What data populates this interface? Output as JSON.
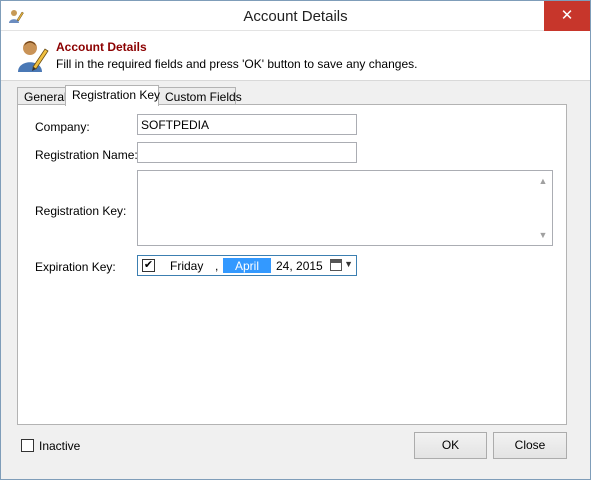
{
  "window": {
    "title": "Account Details",
    "close_glyph": "✕"
  },
  "header": {
    "title": "Account Details",
    "subtitle": "Fill in the required fields and press 'OK' button to save any changes."
  },
  "tabs": [
    {
      "label": "General",
      "active": false
    },
    {
      "label": "Registration Key",
      "active": true
    },
    {
      "label": "Custom Fields",
      "active": false
    }
  ],
  "form": {
    "company": {
      "label": "Company:",
      "value": "SOFTPEDIA"
    },
    "registration_name": {
      "label": "Registration Name:",
      "value": ""
    },
    "registration_key": {
      "label": "Registration Key:",
      "value": ""
    },
    "expiration_key": {
      "label": "Expiration Key:",
      "checked": true,
      "check_glyph": "✔",
      "weekday": "Friday",
      "separator": ",",
      "month": "April",
      "day_year": "24, 2015",
      "dropdown_glyph": "▼"
    }
  },
  "footer": {
    "inactive_label": "Inactive",
    "ok_label": "OK",
    "close_label": "Close"
  },
  "icons": {
    "app_icon": "user-edit-icon",
    "header_icon": "user-pencil-icon",
    "calendar_icon": "calendar-icon",
    "scroll_up_glyph": "▲",
    "scroll_down_glyph": "▼"
  },
  "colors": {
    "header_title": "#8b0000",
    "close_button": "#c7362b",
    "selection": "#3399ff"
  }
}
